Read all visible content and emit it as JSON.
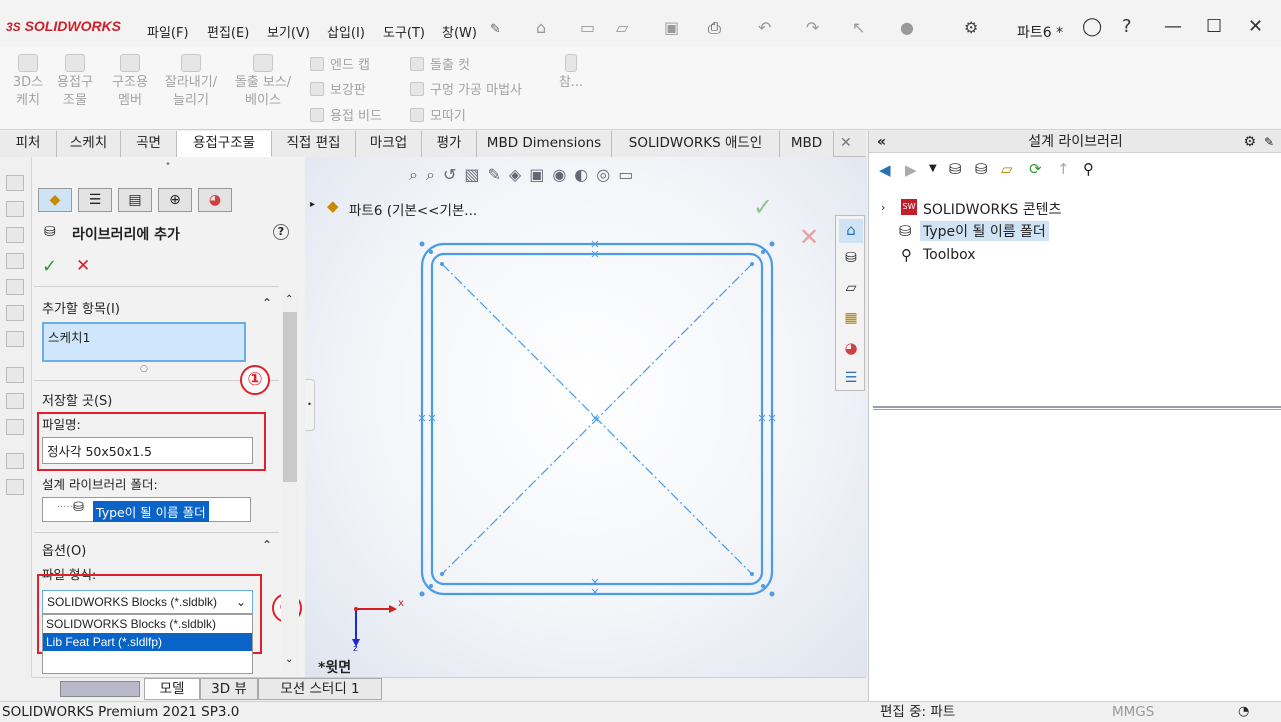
{
  "app": {
    "logo": "SOLIDWORKS",
    "doc_title": "파트6 *"
  },
  "menu": [
    "파일(F)",
    "편집(E)",
    "보기(V)",
    "삽입(I)",
    "도구(T)",
    "창(W)"
  ],
  "commands": {
    "big": [
      {
        "label": "3D스\n케치"
      },
      {
        "label": "용접구\n조물"
      },
      {
        "label": "구조용\n멤버"
      },
      {
        "label": "잘라내기/\n늘리기"
      },
      {
        "label": "돌출 보스/\n베이스"
      }
    ],
    "small_col1": [
      "엔드 캡",
      "보강판",
      "용접 비드"
    ],
    "small_col2": [
      "돌출 컷",
      "구멍 가공 마법사",
      "모따기"
    ],
    "more": "참..."
  },
  "tabs": [
    "피처",
    "스케치",
    "곡면",
    "용접구조물",
    "직접 편집",
    "마크업",
    "평가",
    "MBD Dimensions",
    "SOLIDWORKS 애드인",
    "MBD"
  ],
  "active_tab": "용접구조물",
  "pm": {
    "title": "라이브러리에 추가",
    "items_header": "추가할 항목(I)",
    "items": [
      "스케치1"
    ],
    "save_header": "저장할 곳(S)",
    "filename_label": "파일명:",
    "filename_value": "정사각 50x50x1.5",
    "folder_label": "설계 라이브러리 폴더:",
    "folder_value": "Type이 될 이름 폴더",
    "options_header": "옵션(O)",
    "filetype_label": "파일 형식:",
    "filetype_selected": "SOLIDWORKS Blocks (*.sldblk)",
    "filetype_options": [
      "SOLIDWORKS Blocks (*.sldblk)",
      "Lib Feat Part (*.sldlfp)"
    ],
    "highlighted_option": "Lib Feat Part (*.sldlfp)"
  },
  "annotations": {
    "one": "①",
    "two": "②"
  },
  "graphics": {
    "tree_node": "파트6  (기본<<기본...",
    "view_label": "*윗면",
    "axis_x": "x",
    "axis_z": "z"
  },
  "bottom_tabs": [
    "모델",
    "3D 뷰",
    "모션 스터디 1"
  ],
  "task_pane": {
    "title": "설계 라이브러리",
    "tree": [
      "SOLIDWORKS 콘텐츠",
      "Type이 될 이름 폴더",
      "Toolbox"
    ]
  },
  "status": {
    "left": "SOLIDWORKS Premium 2021 SP3.0",
    "mid": "편집 중: 파트",
    "units": "MMGS"
  },
  "colors": {
    "accent_red": "#e0202a",
    "sketch_blue": "#4a9be8",
    "selection": "#0a64c8"
  }
}
